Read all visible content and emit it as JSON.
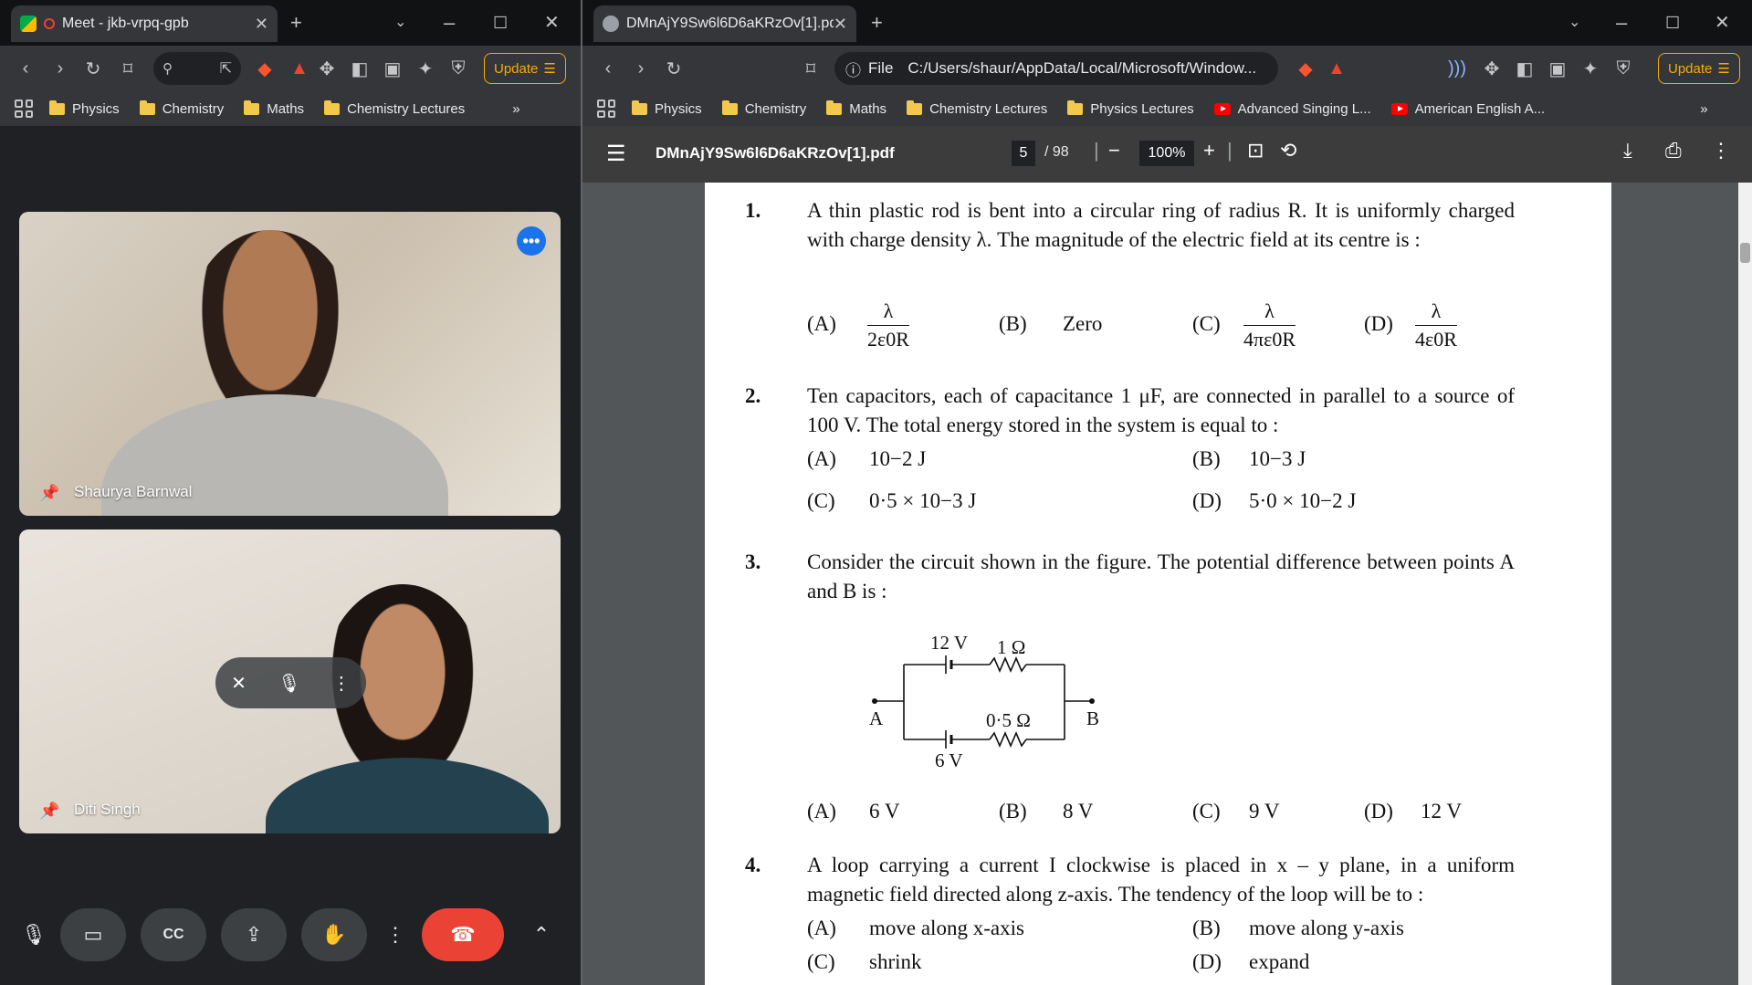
{
  "left": {
    "tab": {
      "title": "Meet - jkb-vrpq-gpb"
    },
    "update_label": "Update",
    "bookmarks": [
      "Physics",
      "Chemistry",
      "Maths",
      "Chemistry Lectures"
    ],
    "overflow": "»",
    "participants": [
      {
        "name": "Shaurya Barnwal"
      },
      {
        "name": "Diti Singh"
      }
    ],
    "controls": [
      "mic",
      "camera",
      "captions",
      "present",
      "raise-hand",
      "more",
      "end-call"
    ]
  },
  "right": {
    "tab": {
      "title": "DMnAjY9Sw6l6D6aKRzOv[1].pd"
    },
    "omnibox": {
      "scheme": "File",
      "url": "C:/Users/shaur/AppData/Local/Microsoft/Window..."
    },
    "update_label": "Update",
    "bookmarks": [
      "Physics",
      "Chemistry",
      "Maths",
      "Chemistry Lectures",
      "Physics Lectures"
    ],
    "yt_bookmarks": [
      "Advanced Singing L...",
      "American English A..."
    ],
    "overflow": "»",
    "pdf": {
      "filename": "DMnAjY9Sw6l6D6aKRzOv[1].pdf",
      "page": "5",
      "total": "/ 98",
      "zoom": "100%"
    },
    "questions": [
      {
        "num": "1.",
        "text": "A thin plastic rod is bent into a circular ring of radius R. It is uniformly charged with charge density λ. The magnitude of the electric field at its centre is :",
        "options": {
          "A_label": "(A)",
          "A_num": "λ",
          "A_den": "2ε0R",
          "B_label": "(B)",
          "B_val": "Zero",
          "C_label": "(C)",
          "C_num": "λ",
          "C_den": "4πε0R",
          "D_label": "(D)",
          "D_num": "λ",
          "D_den": "4ε0R"
        }
      },
      {
        "num": "2.",
        "text": "Ten capacitors, each of capacitance 1 μF, are connected in parallel to a source of 100 V. The total energy stored in the system is equal to :",
        "options": {
          "A_label": "(A)",
          "A_val": "10−2 J",
          "B_label": "(B)",
          "B_val": "10−3 J",
          "C_label": "(C)",
          "C_val": "0·5 × 10−3 J",
          "D_label": "(D)",
          "D_val": "5·0 × 10−2 J"
        }
      },
      {
        "num": "3.",
        "text": "Consider the circuit shown in the figure. The potential difference between points A and B is :",
        "circuit": {
          "v_top": "12 V",
          "r_top": "1 Ω",
          "r_bot": "0·5 Ω",
          "v_bot": "6 V",
          "a": "A",
          "b": "B"
        },
        "options": {
          "A_label": "(A)",
          "A_val": "6 V",
          "B_label": "(B)",
          "B_val": "8 V",
          "C_label": "(C)",
          "C_val": "9 V",
          "D_label": "(D)",
          "D_val": "12 V"
        }
      },
      {
        "num": "4.",
        "text": "A loop carrying a current I clockwise is placed in x – y plane, in a uniform magnetic field directed along z-axis. The tendency of the loop will be to :",
        "options": {
          "A_label": "(A)",
          "A_val": "move along x-axis",
          "B_label": "(B)",
          "B_val": "move along y-axis",
          "C_label": "(C)",
          "C_val": "shrink",
          "D_label": "(D)",
          "D_val": "expand"
        }
      }
    ]
  }
}
